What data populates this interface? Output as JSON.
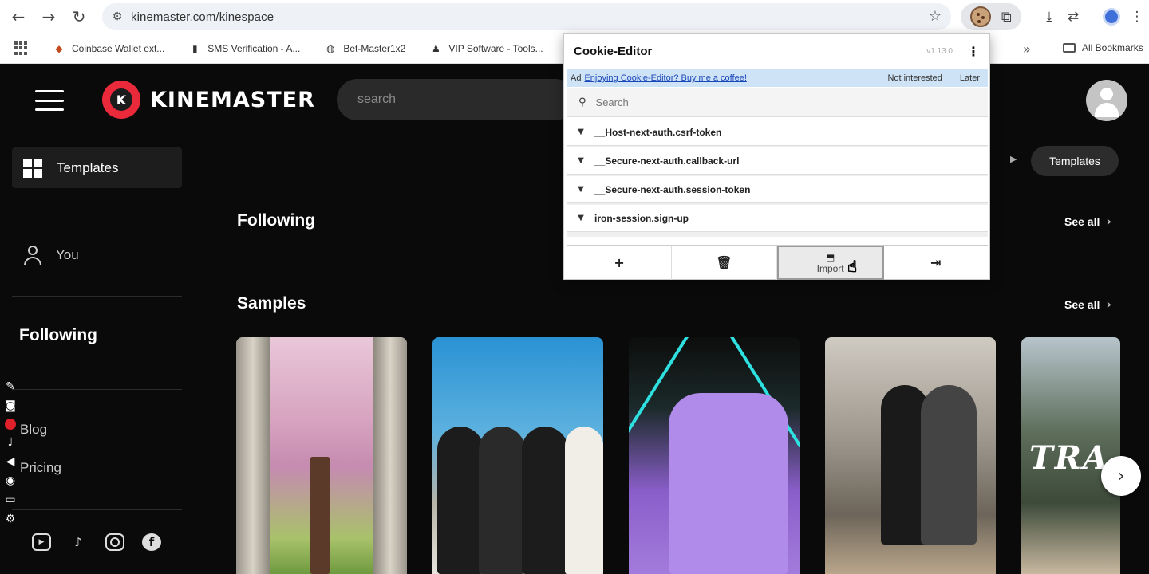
{
  "browser": {
    "url": "kinemaster.com/kinespace",
    "bookmarks": [
      {
        "label": "Coinbase Wallet ext...",
        "icon": "coinbase-icon"
      },
      {
        "label": "SMS Verification - A...",
        "icon": "phone-icon"
      },
      {
        "label": "Bet-Master1x2",
        "icon": "globe-icon"
      },
      {
        "label": "VIP Software - Tools...",
        "icon": "person-icon"
      },
      {
        "label": "",
        "icon": "globe-icon"
      }
    ],
    "all_bookmarks": "All Bookmarks"
  },
  "site": {
    "brand": "KINEMASTER",
    "search_placeholder": "search",
    "sidebar": {
      "templates": "Templates",
      "you": "You",
      "following": "Following",
      "blog": "Blog",
      "pricing": "Pricing"
    },
    "breadcrumb_pill": "Templates",
    "sections": {
      "following": {
        "title": "Following",
        "see_all": "See all"
      },
      "samples": {
        "title": "Samples",
        "see_all": "See all"
      }
    },
    "sample_card_text": "TRA"
  },
  "cookie_editor": {
    "title": "Cookie-Editor",
    "version": "v1.13.0",
    "promo": {
      "ad": "Ad",
      "link": "Enjoying Cookie-Editor? Buy me a coffee!",
      "not_interested": "Not interested",
      "later": "Later"
    },
    "search_placeholder": "Search",
    "cookies": [
      "__Host-next-auth.csrf-token",
      "__Secure-next-auth.callback-url",
      "__Secure-next-auth.session-token",
      "iron-session.sign-up"
    ],
    "actions": {
      "add": "+",
      "delete": "🗑",
      "import_label": "Import",
      "export": "⇥"
    }
  }
}
